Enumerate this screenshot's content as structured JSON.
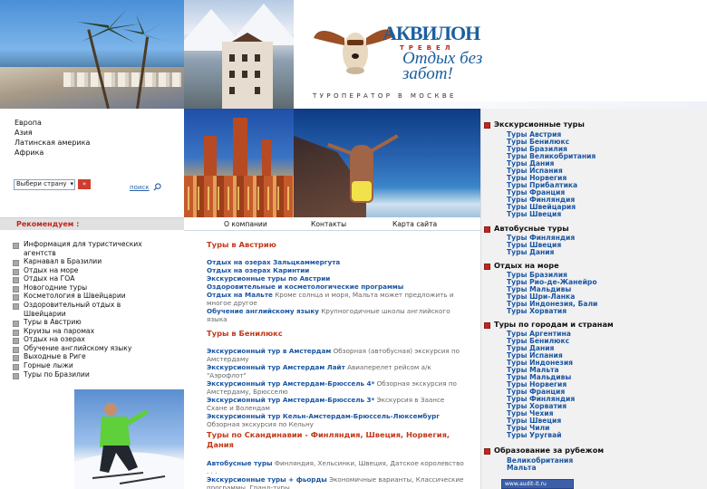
{
  "header": {
    "brand_name": "АКВИЛОН",
    "brand_sub": "ТРЕВЕЛ",
    "slogan": "Отдых без забот!",
    "operator_line": "ТУРОПЕРАТОР В МОСКВЕ"
  },
  "regions": [
    "Европа",
    "Азия",
    "Латинская америка",
    "Африка"
  ],
  "search": {
    "select_value": "Выбери страну",
    "go_label": "»",
    "search_label": "поиск"
  },
  "recommend": {
    "title": "Рекомендуем :",
    "items": [
      "Информация для туристических агентств",
      "Карнавал в Бразилии",
      "Отдых на море",
      "Отдых на ГОА",
      "Новогодние туры",
      "Косметология в Швейцарии",
      "Оздоровительный отдых в Швейцарии",
      "Туры в Австрию",
      "Круизы на паромах",
      "Отдых на озерах",
      "Обучение английскому языку",
      "Выходные в Риге",
      "Горные лыжи",
      "Туры по Бразилии"
    ]
  },
  "menu": {
    "about": "О компании",
    "contacts": "Контакты",
    "sitemap": "Карта сайта"
  },
  "main": {
    "austria": {
      "title": "Туры в Австрию",
      "items": [
        {
          "link": "Отдых на озерах Зальцкаммергута",
          "desc": ""
        },
        {
          "link": "Отдых на озерах Каринтии",
          "desc": ""
        },
        {
          "link": "Экскурсионные туры по Австрии",
          "desc": ""
        },
        {
          "link": "Оздоровительные и косметологические программы",
          "desc": ""
        },
        {
          "link": "Отдых на Мальте",
          "desc": "Кроме солнца и моря, Мальта может предложить и многое другое"
        },
        {
          "link": "Обучение английскому языку",
          "desc": "Крупногодичные школы английского языка"
        }
      ]
    },
    "benelux": {
      "title": "Туры в Бенилюкс",
      "items": [
        {
          "link": "Экскурсионный тур в Амстердам",
          "desc": "Обзорная (автобусная) экскурсия по Амстердаму"
        },
        {
          "link": "Экскурсионный тур Амстердам Лайт",
          "desc": "Авиаперелет рейсом а/к \"Аэрофлот\""
        },
        {
          "link": "Экскурсионный тур Амстердам-Брюссель 4*",
          "desc": "Обзорная экскурсия по Амстердаму, Брюсселю"
        },
        {
          "link": "Экскурсионный тур Амстердам-Брюссель 3*",
          "desc": "Экскурсия в Заансе Схане и Волендам"
        },
        {
          "link": "Экскурсионный тур Кельн-Амстердам-Брюссель-Люксембург",
          "desc": "Обзорная экскурсия по Кельну"
        }
      ]
    },
    "scandinavia": {
      "title": "Туры по Скандинавии - Финляндия, Швеция, Норвегия, Дания",
      "items": [
        {
          "link": "Автобусные туры",
          "desc": "Финляндия, Хельсинки, Швеция, Датское королевство . . ."
        },
        {
          "link": "Экскурсионные туры + фьорды",
          "desc": "Экономичные варианты, Классические программы, Гранд-туры"
        }
      ]
    }
  },
  "right": {
    "sections": [
      {
        "title": "Экскурсионные туры",
        "items": [
          "Туры Австрия",
          "Туры Бенилюкс",
          "Туры Бразилия",
          "Туры Великобритания",
          "Туры Дания",
          "Туры Испания",
          "Туры Норвегия",
          "Туры Прибалтика",
          "Туры Франция",
          "Туры Финляндия",
          "Туры Швейцария",
          "Туры Швеция"
        ]
      },
      {
        "title": "Автобусные туры",
        "items": [
          "Туры Финляндия",
          "Туры Швеция",
          "Туры Дания"
        ]
      },
      {
        "title": "Отдых на море",
        "items": [
          "Туры Бразилия",
          "Туры Рио-де-Жанейро",
          "Туры Мальдивы",
          "Туры Шри-Ланка",
          "Туры Индонезия, Бали",
          "Туры Хорватия"
        ]
      },
      {
        "title": "Туры по городам и странам",
        "items": [
          "Туры Аргентина",
          "Туры Бенилюкс",
          "Туры Дания",
          "Туры Испания",
          "Туры Индонезия",
          "Туры Мальта",
          "Туры Мальдивы",
          "Туры Норвегия",
          "Туры Франция",
          "Туры Финляндия",
          "Туры Хорватия",
          "Туры Чехия",
          "Туры Швеция",
          "Туры Чили",
          "Туры Уругвай"
        ]
      },
      {
        "title": "Образование за рубежом",
        "items": [
          "Великобритания",
          "Мальта"
        ]
      }
    ],
    "badge": "www.audit-it.ru"
  }
}
